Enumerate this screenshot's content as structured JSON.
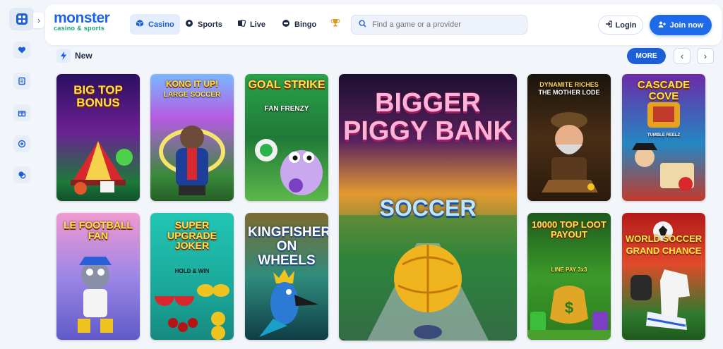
{
  "brand": {
    "name": "monster",
    "tagline": "casino & sports"
  },
  "sidebar": {
    "toggle_glyph": "›",
    "icons": [
      "menu-grid-icon",
      "heart-icon",
      "coupon-icon",
      "gift-icon",
      "target-icon",
      "chat-icon"
    ]
  },
  "nav": [
    {
      "label": "Casino",
      "icon": "casino-cube-icon",
      "active": true
    },
    {
      "label": "Sports",
      "icon": "soccer-ball-icon"
    },
    {
      "label": "Live",
      "icon": "live-cards-icon"
    },
    {
      "label": "Bingo",
      "icon": "bingo-icon"
    }
  ],
  "search": {
    "placeholder": "Find a game or a provider"
  },
  "auth": {
    "login_label": "Login",
    "join_label": "Join now"
  },
  "section": {
    "title": "New",
    "more_label": "MORE",
    "prev_glyph": "‹",
    "next_glyph": "›"
  },
  "games": [
    {
      "title": "BIG TOP BONUS",
      "subtitle": ""
    },
    {
      "title": "KONG IT UP!",
      "subtitle": "LARGE SOCCER"
    },
    {
      "title": "GOAL STRIKE",
      "subtitle": "FAN FRENZY"
    },
    {
      "title": "BIGGER PIGGY BANK",
      "subtitle": "SOCCER"
    },
    {
      "title": "DYNAMITE RICHES",
      "subtitle": "THE MOTHER LODE"
    },
    {
      "title": "CASCADE COVE",
      "subtitle": "TUMBLE REELZ"
    },
    {
      "title": "LE FOOTBALL FAN",
      "subtitle": ""
    },
    {
      "title": "SUPER UPGRADE JOKER",
      "subtitle": "HOLD & WIN"
    },
    {
      "title": "KINGFISHER ON WHEELS",
      "subtitle": ""
    },
    {
      "title": "10000 TOP LOOT PAYOUT",
      "subtitle": "LINE PAY 3x3"
    },
    {
      "title": "WORLD SOCCER",
      "subtitle": "GRAND CHANCE"
    }
  ]
}
